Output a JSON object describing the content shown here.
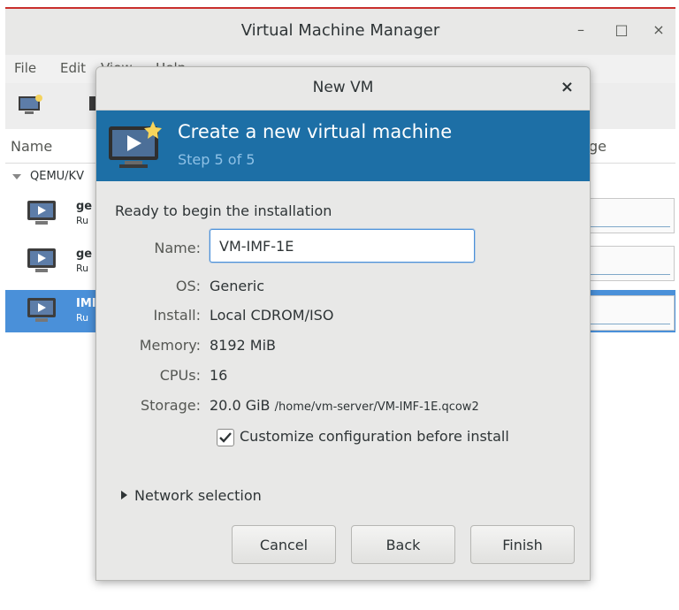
{
  "main_window": {
    "title": "Virtual Machine Manager",
    "controls": {
      "minimize": "–",
      "maximize": "□",
      "close": "×"
    },
    "menu": [
      "File",
      "Edit",
      "View",
      "Help"
    ],
    "columns": {
      "name": "Name",
      "usage": "ge"
    },
    "connection": "QEMU/KV",
    "vms": [
      {
        "name": "ge",
        "status": "Ru"
      },
      {
        "name": "ge",
        "status": "Ru"
      },
      {
        "name": "IMI",
        "status": "Ru"
      }
    ]
  },
  "dialog": {
    "title": "New VM",
    "close": "×",
    "banner": {
      "title": "Create a new virtual machine",
      "step": "Step 5 of 5"
    },
    "ready_text": "Ready to begin the installation",
    "fields": {
      "name_label": "Name:",
      "name_value": "VM-IMF-1E",
      "os_label": "OS:",
      "os_value": "Generic",
      "install_label": "Install:",
      "install_value": "Local CDROM/ISO",
      "memory_label": "Memory:",
      "memory_value": "8192 MiB",
      "cpus_label": "CPUs:",
      "cpus_value": "16",
      "storage_label": "Storage:",
      "storage_value": "20.0 GiB",
      "storage_path": "/home/vm-server/VM-IMF-1E.qcow2"
    },
    "customize_label": "Customize configuration before install",
    "customize_checked": true,
    "network_expander": "Network selection",
    "buttons": {
      "cancel": "Cancel",
      "back": "Back",
      "finish": "Finish"
    }
  },
  "colors": {
    "banner": "#1d6fa6",
    "selection": "#4a90d9",
    "step_text": "#8ec1e6"
  }
}
